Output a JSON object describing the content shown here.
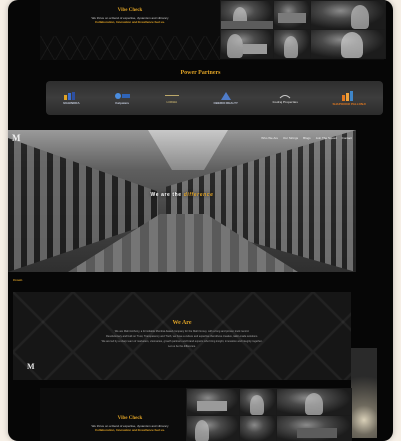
{
  "vibe": {
    "title": "Vibe Check",
    "line1": "We thrive on a blend of expertise, dynamism and vibrancy",
    "line2_pre": "",
    "line2_hl": "Collaboration, Innovation and Excellence fuel us."
  },
  "partners": {
    "title": "Power Partners",
    "logos": [
      {
        "name": "MAHINDRA",
        "color": "#3b6fd1"
      },
      {
        "name": "Kalpataru",
        "color": "#4a8de0"
      },
      {
        "name": "LODHA",
        "color": "#bca86a"
      },
      {
        "name": "OBEROI REALTY",
        "color": "#4f7cc9"
      },
      {
        "name": "Godrej Properties",
        "color": "#c8c8c8"
      },
      {
        "name": "SHAPOORJI PALLONJI",
        "color": "#e57a1f"
      }
    ]
  },
  "hero": {
    "logo": "M",
    "nav": [
      "Who We Are",
      "Our Strings",
      "Blogs",
      "Join The Squad",
      "Contact"
    ],
    "tagline_a": "We are the",
    "tagline_b": "difference"
  },
  "brand_label": "Crown",
  "who": {
    "title": "We Are",
    "p1": "We are Mahi Anthony, a formidable Mumbai-based company for the Mahi Group, with a long and proven track record.",
    "p2": "Revolutionary and built on Trust, Transparency and Truth, we have a culture and expertise that drives creative, tailor-made solutions.",
    "p3": "We are led by a sharp team of marketers, visionaries, growth partners and brand experts who bring insight, innovation and integrity together.",
    "p4": "Let us be the difference.",
    "logo": "M"
  },
  "colors": {
    "accent": "#e0a326",
    "background": "#060606",
    "page": "#f6efe6"
  }
}
